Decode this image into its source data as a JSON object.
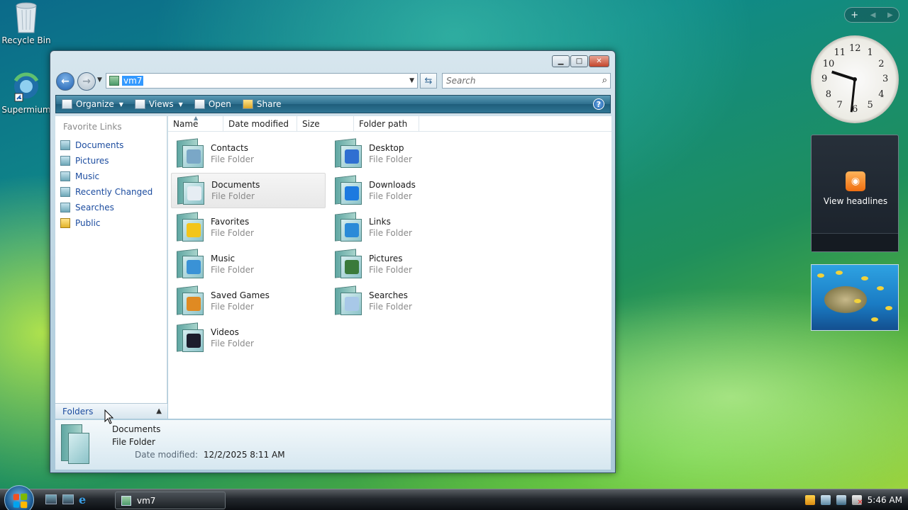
{
  "desktop": {
    "icons": [
      {
        "label": "Recycle Bin"
      },
      {
        "label": "Supermium"
      }
    ]
  },
  "window": {
    "address": {
      "text": "vm7"
    },
    "search": {
      "placeholder": "Search"
    },
    "toolbar": {
      "organize": "Organize",
      "views": "Views",
      "open": "Open",
      "share": "Share"
    },
    "left_pane": {
      "title": "Favorite Links",
      "items": [
        {
          "label": "Documents"
        },
        {
          "label": "Pictures"
        },
        {
          "label": "Music"
        },
        {
          "label": "Recently Changed"
        },
        {
          "label": "Searches"
        },
        {
          "label": "Public"
        }
      ],
      "folders_label": "Folders"
    },
    "columns": [
      "Name",
      "Date modified",
      "Size",
      "Folder path"
    ],
    "items": [
      {
        "name": "Contacts",
        "type": "File Folder",
        "emblem": "contact-card-icon",
        "color": "#7aa7c7"
      },
      {
        "name": "Desktop",
        "type": "File Folder",
        "emblem": "monitor-icon",
        "color": "#2f6fd1"
      },
      {
        "name": "Documents",
        "type": "File Folder",
        "emblem": "document-icon",
        "color": "#e6edf3"
      },
      {
        "name": "Downloads",
        "type": "File Folder",
        "emblem": "download-arrow-icon",
        "color": "#1d7ae0"
      },
      {
        "name": "Favorites",
        "type": "File Folder",
        "emblem": "star-icon",
        "color": "#f3c51a"
      },
      {
        "name": "Links",
        "type": "File Folder",
        "emblem": "link-arrow-icon",
        "color": "#2a8ad8"
      },
      {
        "name": "Music",
        "type": "File Folder",
        "emblem": "music-icon",
        "color": "#3a92d6"
      },
      {
        "name": "Pictures",
        "type": "File Folder",
        "emblem": "picture-icon",
        "color": "#3a7a3a"
      },
      {
        "name": "Saved Games",
        "type": "File Folder",
        "emblem": "trophy-icon",
        "color": "#e08a22"
      },
      {
        "name": "Searches",
        "type": "File Folder",
        "emblem": "magnifier-icon",
        "color": "#a8c8e8"
      },
      {
        "name": "Videos",
        "type": "File Folder",
        "emblem": "film-icon",
        "color": "#1c1c2c"
      }
    ],
    "details": {
      "name": "Documents",
      "type": "File Folder",
      "date_label": "Date modified:",
      "date_value": "12/2/2025 8:11 AM"
    }
  },
  "gadgets": {
    "rss_label": "View headlines",
    "clock_numbers": [
      "12",
      "1",
      "2",
      "3",
      "4",
      "5",
      "6",
      "7",
      "8",
      "9",
      "10",
      "11"
    ]
  },
  "taskbar": {
    "window_button": "vm7",
    "time": "5:46 AM"
  }
}
